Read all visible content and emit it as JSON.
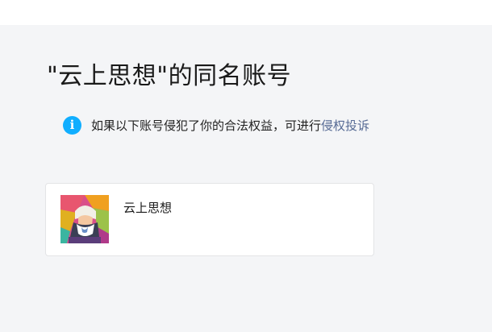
{
  "page": {
    "title": "\"云上思想\"的同名账号"
  },
  "notice": {
    "icon": "info-icon",
    "text": "如果以下账号侵犯了你的合法权益，可进行",
    "link_label": "侵权投诉"
  },
  "accounts": [
    {
      "name": "云上思想",
      "avatar": "pop-art-portrait-avatar"
    }
  ],
  "colors": {
    "background": "#f4f5f7",
    "link": "#576b95",
    "info_icon": "#10aeff"
  }
}
